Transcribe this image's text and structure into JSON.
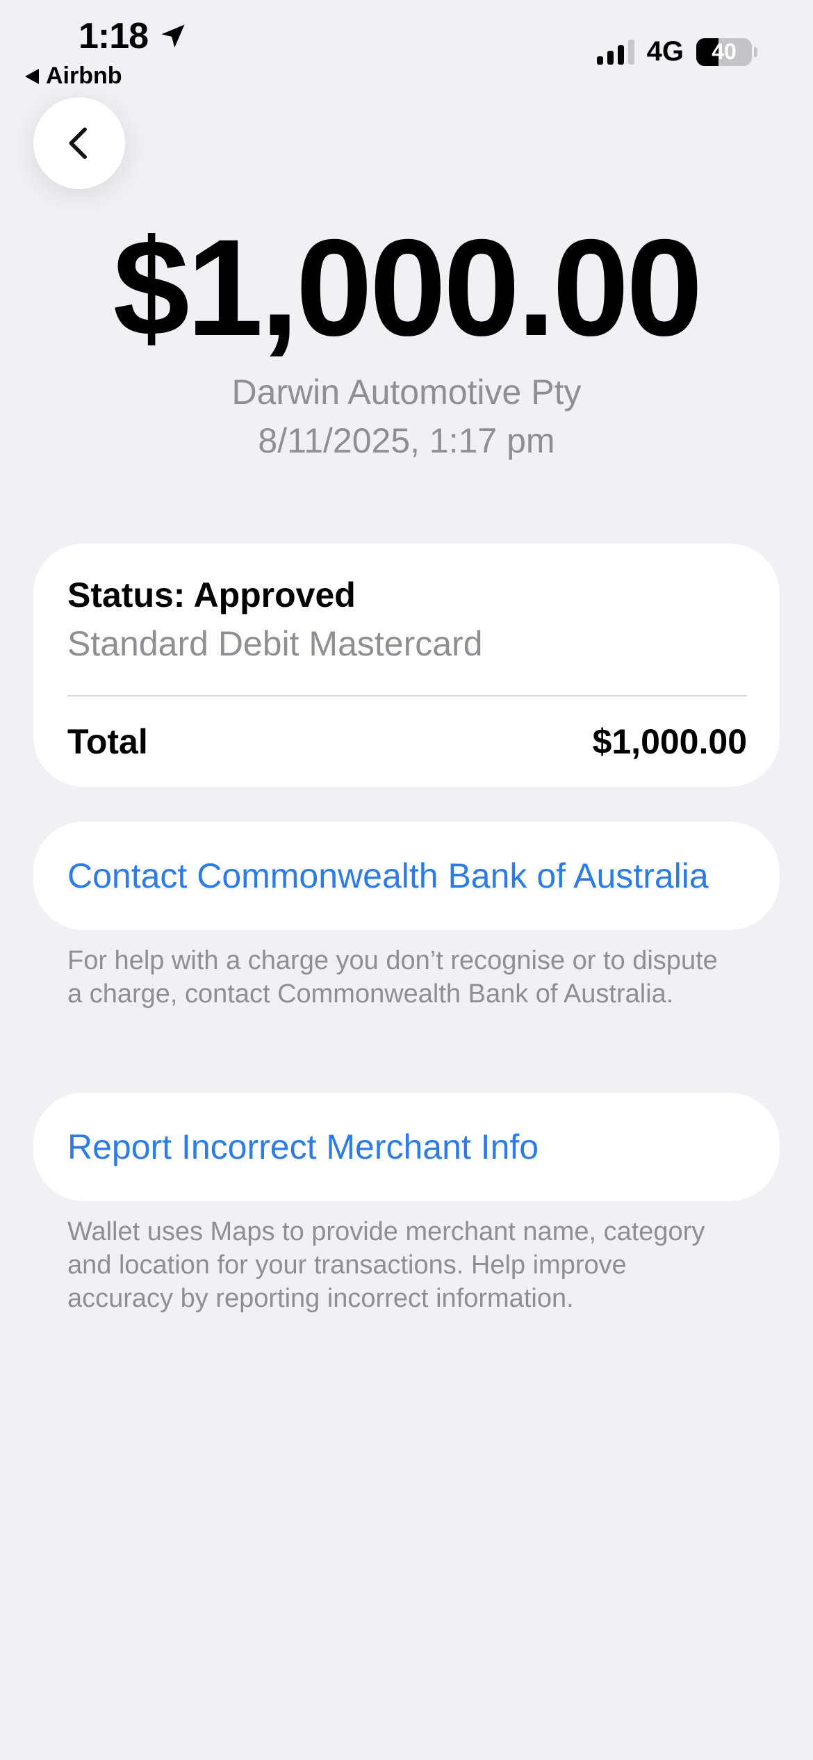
{
  "status_bar": {
    "time": "1:18",
    "back_app": "Airbnb",
    "network": "4G",
    "battery": "40",
    "battery_level_percent": 40,
    "signal_bars_active": 3,
    "signal_bars_total": 4
  },
  "transaction": {
    "amount": "$1,000.00",
    "merchant": "Darwin Automotive Pty",
    "datetime": "8/11/2025, 1:17 pm"
  },
  "status_card": {
    "status": "Status: Approved",
    "card_type": "Standard Debit Mastercard",
    "total_label": "Total",
    "total_value": "$1,000.00"
  },
  "contact": {
    "link": "Contact Commonwealth Bank of Australia",
    "note": "For help with a charge you don’t recognise or to dispute a charge, contact Commonwealth Bank of Australia."
  },
  "report": {
    "link": "Report Incorrect Merchant Info",
    "note": "Wallet uses Maps to provide merchant name, category and location for your transactions. Help improve accuracy by reporting incorrect information."
  },
  "colors": {
    "background": "#f0f0f5",
    "accent": "#2d7be5",
    "secondary_text": "#8e8e93"
  },
  "icons": {
    "location": "location-arrow-icon",
    "back": "chevron-left-icon"
  }
}
